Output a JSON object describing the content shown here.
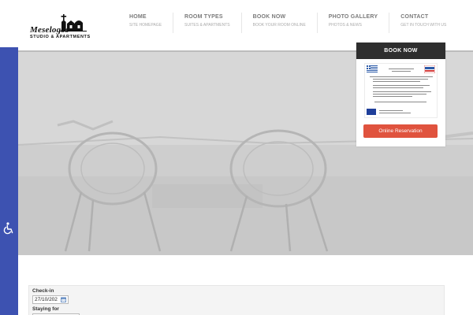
{
  "logo": {
    "brand": "Meselogos",
    "tagline": "STUDIO & APARTMENTS"
  },
  "nav": {
    "items": [
      {
        "title": "HOME",
        "subtitle": "SITE HOMEPAGE"
      },
      {
        "title": "ROOM TYPES",
        "subtitle": "SUITES & APARTMENTS"
      },
      {
        "title": "BOOK NOW",
        "subtitle": "BOOK YOUR ROOM ONLINE"
      },
      {
        "title": "PHOTO GALLERY",
        "subtitle": "PHOTOS & NEWS"
      },
      {
        "title": "CONTACT",
        "subtitle": "GET IN TOUCH WITH US"
      }
    ]
  },
  "accessibility": {
    "icon": "wheelchair-icon",
    "color": "#3d52b1"
  },
  "booking_panel": {
    "heading": "BOOK NOW",
    "button_label": "Online Reservation",
    "button_color": "#e0533e"
  },
  "search": {
    "checkin_label": "Check-in",
    "checkin_value": "27/10/202",
    "staying_label": "Staying for"
  }
}
